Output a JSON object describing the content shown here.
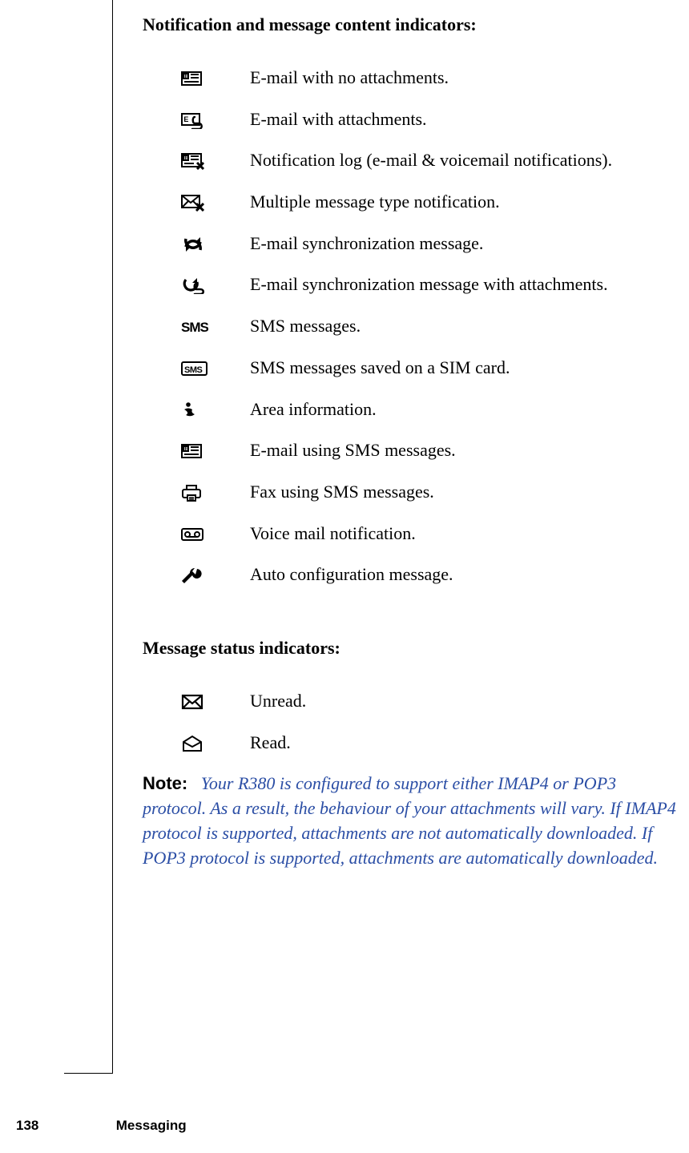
{
  "section1_heading": "Notification and message content indicators:",
  "indicators1": [
    {
      "icon": "email-plain-icon",
      "desc": "E-mail with no attachments."
    },
    {
      "icon": "email-attach-icon",
      "desc": "E-mail with attachments."
    },
    {
      "icon": "notification-log-icon",
      "desc": "Notification log (e-mail & voicemail notifications)."
    },
    {
      "icon": "multi-message-icon",
      "desc": "Multiple message type notification."
    },
    {
      "icon": "email-sync-icon",
      "desc": "E-mail synchronization message."
    },
    {
      "icon": "email-sync-attach-icon",
      "desc": "E-mail synchronization message with attachments."
    },
    {
      "icon": "sms-text-icon",
      "desc": "SMS messages."
    },
    {
      "icon": "sms-sim-icon",
      "desc": "SMS messages saved on a SIM card."
    },
    {
      "icon": "info-icon",
      "desc": "Area information."
    },
    {
      "icon": "email-sms-icon",
      "desc": "E-mail using SMS messages."
    },
    {
      "icon": "fax-sms-icon",
      "desc": "Fax using SMS messages."
    },
    {
      "icon": "voicemail-icon",
      "desc": "Voice mail notification."
    },
    {
      "icon": "wrench-icon",
      "desc": "Auto configuration message."
    }
  ],
  "section2_heading": "Message status indicators:",
  "indicators2": [
    {
      "icon": "unread-icon",
      "desc": "Unread."
    },
    {
      "icon": "read-icon",
      "desc": "Read."
    }
  ],
  "note_label": "Note:",
  "note_body": "Your R380 is configured to support either IMAP4 or POP3 protocol. As a result, the behaviour of your attachments will vary. If IMAP4 protocol is supported, attachments are not automatically downloaded. If POP3 protocol is supported, attachments are automatically downloaded.",
  "footer_page": "138",
  "footer_section": "Messaging"
}
